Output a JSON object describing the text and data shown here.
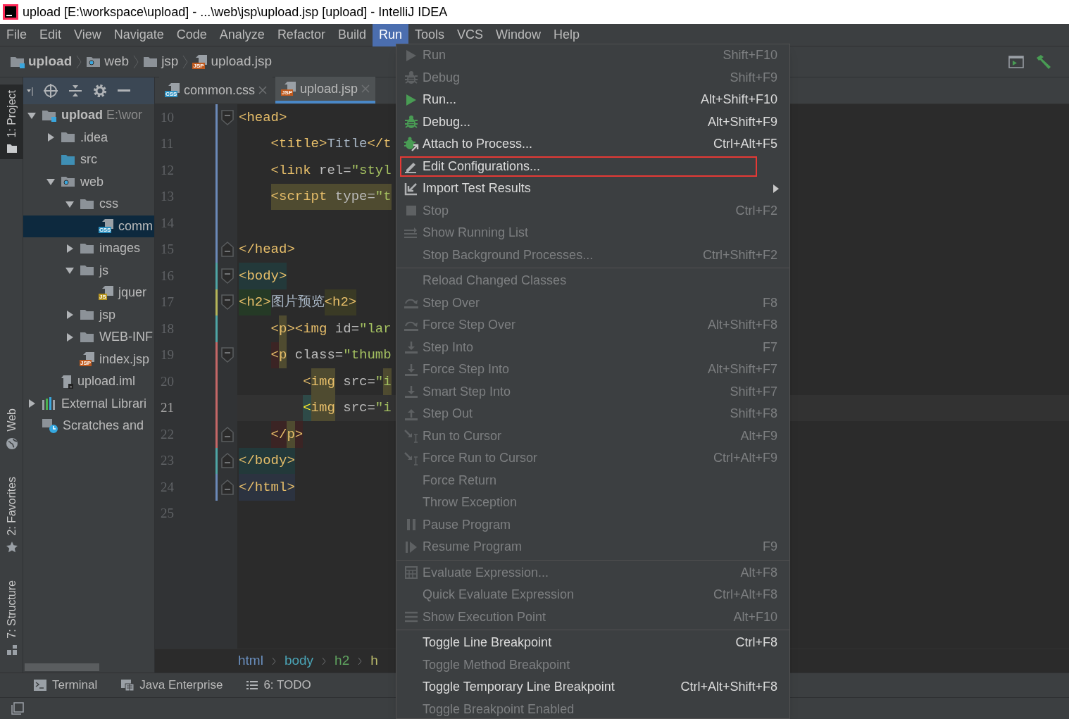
{
  "window": {
    "title": "upload [E:\\workspace\\upload] - ...\\web\\jsp\\upload.jsp [upload] - IntelliJ IDEA"
  },
  "menu_bar": [
    {
      "label": "File",
      "selected": false
    },
    {
      "label": "Edit",
      "selected": false
    },
    {
      "label": "View",
      "selected": false
    },
    {
      "label": "Navigate",
      "selected": false
    },
    {
      "label": "Code",
      "selected": false
    },
    {
      "label": "Analyze",
      "selected": false
    },
    {
      "label": "Refactor",
      "selected": false
    },
    {
      "label": "Build",
      "selected": false
    },
    {
      "label": "Run",
      "selected": true
    },
    {
      "label": "Tools",
      "selected": false
    },
    {
      "label": "VCS",
      "selected": false
    },
    {
      "label": "Window",
      "selected": false
    },
    {
      "label": "Help",
      "selected": false
    }
  ],
  "nav_breadcrumbs": [
    {
      "label": "upload",
      "kind": "module"
    },
    {
      "label": "web",
      "kind": "web-folder"
    },
    {
      "label": "jsp",
      "kind": "folder"
    },
    {
      "label": "upload.jsp",
      "kind": "jsp-file",
      "badge": "JSP"
    }
  ],
  "tool_strip_top": [
    {
      "label": "1: Project",
      "kind": "folder",
      "selected": true
    }
  ],
  "tool_strip_bottom": [
    {
      "label": "Web",
      "kind": "globe",
      "selected": false
    },
    {
      "label": "2: Favorites",
      "kind": "star",
      "selected": false
    },
    {
      "label": "7: Structure",
      "kind": "structure",
      "selected": false
    }
  ],
  "project_tree": [
    {
      "label": "upload",
      "detail": "E:\\wor",
      "kind": "module",
      "expanded": true,
      "selected": false,
      "children": [
        {
          "label": ".idea",
          "kind": "folder",
          "expanded": false,
          "selected": false
        },
        {
          "label": "src",
          "kind": "source-folder",
          "selected": false
        },
        {
          "label": "web",
          "kind": "web-folder",
          "expanded": true,
          "selected": false,
          "children": [
            {
              "label": "css",
              "kind": "folder",
              "expanded": true,
              "selected": false,
              "children": [
                {
                  "label": "comm",
                  "kind": "css-file",
                  "badge": "CSS",
                  "selected": true
                }
              ]
            },
            {
              "label": "images",
              "kind": "folder",
              "expanded": false,
              "selected": false
            },
            {
              "label": "js",
              "kind": "folder",
              "expanded": true,
              "selected": false,
              "children": [
                {
                  "label": "jquer",
                  "kind": "js-file",
                  "badge": "JS",
                  "selected": false
                }
              ]
            },
            {
              "label": "jsp",
              "kind": "folder",
              "expanded": false,
              "selected": false
            },
            {
              "label": "WEB-INF",
              "kind": "folder",
              "expanded": false,
              "selected": false
            },
            {
              "label": "index.jsp",
              "kind": "jsp-file",
              "badge": "JSP",
              "selected": false
            }
          ]
        },
        {
          "label": "upload.iml",
          "kind": "iml-file",
          "selected": false
        }
      ]
    },
    {
      "label": "External Librari",
      "kind": "libraries",
      "expanded": false,
      "selected": false
    },
    {
      "label": "Scratches and",
      "kind": "scratches",
      "selected": false
    }
  ],
  "editor_tabs": [
    {
      "label": "common.css",
      "kind": "css-file",
      "badge": "CSS",
      "selected": false
    },
    {
      "label": "upload.jsp",
      "kind": "jsp-file",
      "badge": "JSP",
      "selected": true
    }
  ],
  "code_lines": [
    {
      "number": "10",
      "color": "#6b89b8",
      "kind": "flat",
      "fold_start": true,
      "fold_end": false,
      "current": false,
      "segments": [
        {
          "text": "<head>",
          "kind": "tag"
        }
      ]
    },
    {
      "number": "11",
      "color": "#6b89b8",
      "kind": "nested",
      "fold_start": false,
      "fold_end": false,
      "current": false,
      "segments": [
        {
          "text": "<title>",
          "kind": "tag"
        },
        {
          "text": "Title",
          "kind": "text"
        },
        {
          "text": "</t",
          "kind": "tag"
        }
      ]
    },
    {
      "number": "12",
      "color": "#6b89b8",
      "kind": "nested",
      "fold_start": false,
      "fold_end": false,
      "current": false,
      "segments": [
        {
          "text": "<link",
          "kind": "tag"
        },
        {
          "text": " rel=",
          "kind": "attr"
        },
        {
          "text": "\"styl",
          "kind": "value"
        }
      ]
    },
    {
      "number": "13",
      "color": "#6b89b8",
      "kind": "nested",
      "fold_start": false,
      "fold_end": false,
      "current": false,
      "segments": [
        {
          "text": "<script",
          "kind": "tag",
          "color": "#4f4b30"
        },
        {
          "text": " type=",
          "kind": "attr",
          "color": "#4f4b30"
        },
        {
          "text": "\"t",
          "kind": "value",
          "color": "#4f4b30"
        }
      ]
    },
    {
      "number": "14",
      "color": "#6b89b8",
      "fold_start": false,
      "fold_end": false,
      "current": false
    },
    {
      "number": "15",
      "color": "#6b89b8",
      "kind": "flat",
      "fold_start": false,
      "fold_end": true,
      "current": false,
      "segments": [
        {
          "text": "</head>",
          "kind": "tag"
        }
      ]
    },
    {
      "number": "16",
      "color": "#4fa5a5",
      "kind": "flat",
      "fold_start": true,
      "fold_end": false,
      "current": false,
      "segments": [
        {
          "text": "<body>",
          "kind": "tag",
          "color": "#23393a"
        }
      ]
    },
    {
      "number": "17",
      "color": "#b5b55a",
      "kind": "flat",
      "fold_start": true,
      "fold_end": false,
      "current": false,
      "segments": [
        {
          "text": "<h2>",
          "kind": "tag",
          "color": "#253a26"
        },
        {
          "text": "图片预览",
          "kind": "text"
        },
        {
          "text": "<h2>",
          "kind": "tag",
          "color": "#3a3a25"
        }
      ]
    },
    {
      "number": "18",
      "color": "#4fa5a5",
      "kind": "nested",
      "fold_start": false,
      "fold_end": false,
      "current": false,
      "segments": [
        {
          "text": "<",
          "kind": "tag"
        },
        {
          "text": "p",
          "kind": "tag",
          "color": "#4f4b30"
        },
        {
          "text": "><img",
          "kind": "tag"
        },
        {
          "text": " id=",
          "kind": "attr"
        },
        {
          "text": "\"lar",
          "kind": "value"
        }
      ]
    },
    {
      "number": "19",
      "color": "#c46767",
      "kind": "nested",
      "fold_start": true,
      "fold_end": false,
      "current": false,
      "segments": [
        {
          "text": "<",
          "kind": "tag",
          "color": "#3b2424"
        },
        {
          "text": "p",
          "kind": "tag",
          "color": "#4f4b30"
        },
        {
          "text": " class=",
          "kind": "attr"
        },
        {
          "text": "\"thumb",
          "kind": "value"
        }
      ]
    },
    {
      "number": "20",
      "color": "#c46767",
      "kind": "deep",
      "fold_start": false,
      "fold_end": false,
      "current": false,
      "segments": [
        {
          "text": "<",
          "kind": "tag"
        },
        {
          "text": "img",
          "kind": "tag",
          "color": "#4f4b30"
        },
        {
          "text": " src=",
          "kind": "attr"
        },
        {
          "text": "\"",
          "kind": "value"
        },
        {
          "text": "i",
          "kind": "value",
          "color": "#4f4b30"
        }
      ]
    },
    {
      "number": "21",
      "color": "#c46767",
      "kind": "deep",
      "fold_start": false,
      "fold_end": false,
      "current": true,
      "segments": [
        {
          "text": "<",
          "kind": "bracket",
          "color": "#2e4a48"
        },
        {
          "text": "img",
          "kind": "tag",
          "color": "#4f4b30"
        },
        {
          "text": " src=",
          "kind": "attr"
        },
        {
          "text": "\"i",
          "kind": "value"
        }
      ]
    },
    {
      "number": "22",
      "color": "#c46767",
      "kind": "nested",
      "fold_start": false,
      "fold_end": true,
      "current": false,
      "segments": [
        {
          "text": "</",
          "kind": "tag",
          "color": "#3b2424"
        },
        {
          "text": "p",
          "kind": "tag",
          "color": "#4f4b30"
        },
        {
          "text": ">",
          "kind": "tag",
          "color": "#3b2424"
        }
      ]
    },
    {
      "number": "23",
      "color": "#4fa5a5",
      "kind": "flat",
      "fold_start": false,
      "fold_end": true,
      "current": false,
      "segments": [
        {
          "text": "</body>",
          "kind": "tag",
          "color": "#23393a"
        }
      ]
    },
    {
      "number": "24",
      "color": "#6b89b8",
      "kind": "flat",
      "fold_start": false,
      "fold_end": true,
      "current": false,
      "segments": [
        {
          "text": "</html>",
          "kind": "tag",
          "color": "#2c3340"
        }
      ]
    },
    {
      "number": "25",
      "fold_start": false,
      "fold_end": false,
      "current": false
    }
  ],
  "editor_breadcrumbs": [
    {
      "label": "html",
      "color": "#6a8fbf"
    },
    {
      "label": "body",
      "color": "#4aa3b5"
    },
    {
      "label": "h2",
      "color": "#5fa35f"
    },
    {
      "label": "h",
      "color": "#b8b86a"
    }
  ],
  "bottom_tools": [
    {
      "label": "Terminal",
      "kind": "terminal"
    },
    {
      "label": "Java Enterprise",
      "kind": "java-ee"
    },
    {
      "label": "6: TODO",
      "kind": "todo"
    }
  ],
  "run_menu": [
    {
      "kind": "play",
      "label": "Run",
      "shortcut": "Shift+F10",
      "disabled": true,
      "boxed": false
    },
    {
      "kind": "bug",
      "label": "Debug",
      "shortcut": "Shift+F9",
      "disabled": true,
      "boxed": false
    },
    {
      "kind": "play",
      "label": "Run...",
      "shortcut": "Alt+Shift+F10",
      "disabled": false,
      "boxed": false
    },
    {
      "kind": "bug",
      "label": "Debug...",
      "shortcut": "Alt+Shift+F9",
      "disabled": false,
      "boxed": false
    },
    {
      "kind": "attach",
      "label": "Attach to Process...",
      "shortcut": "Ctrl+Alt+F5",
      "disabled": false,
      "boxed": false
    },
    {
      "kind": "pencil",
      "label": "Edit Configurations...",
      "disabled": false,
      "boxed": true
    },
    {
      "kind": "import-submenu",
      "label": "Import Test Results",
      "disabled": false,
      "boxed": false
    },
    {
      "kind": "stop",
      "label": "Stop",
      "shortcut": "Ctrl+F2",
      "disabled": true,
      "boxed": false
    },
    {
      "kind": "list",
      "label": "Show Running List",
      "disabled": true,
      "boxed": false
    },
    {
      "kind": "plain",
      "label": "Stop Background Processes...",
      "shortcut": "Ctrl+Shift+F2",
      "disabled": true,
      "boxed": false
    },
    {
      "kind": "separator"
    },
    {
      "kind": "plain",
      "label": "Reload Changed Classes",
      "disabled": true,
      "boxed": false
    },
    {
      "kind": "step-over",
      "label": "Step Over",
      "shortcut": "F8",
      "disabled": true,
      "boxed": false
    },
    {
      "kind": "step-over",
      "label": "Force Step Over",
      "shortcut": "Alt+Shift+F8",
      "disabled": true,
      "boxed": false
    },
    {
      "kind": "step-into",
      "label": "Step Into",
      "shortcut": "F7",
      "disabled": true,
      "boxed": false
    },
    {
      "kind": "step-into",
      "label": "Force Step Into",
      "shortcut": "Alt+Shift+F7",
      "disabled": true,
      "boxed": false
    },
    {
      "kind": "step-into",
      "label": "Smart Step Into",
      "shortcut": "Shift+F7",
      "disabled": true,
      "boxed": false
    },
    {
      "kind": "step-out",
      "label": "Step Out",
      "shortcut": "Shift+F8",
      "disabled": true,
      "boxed": false
    },
    {
      "kind": "cursor",
      "label": "Run to Cursor",
      "shortcut": "Alt+F9",
      "disabled": true,
      "boxed": false
    },
    {
      "kind": "cursor",
      "label": "Force Run to Cursor",
      "shortcut": "Ctrl+Alt+F9",
      "disabled": true,
      "boxed": false
    },
    {
      "kind": "plain",
      "label": "Force Return",
      "disabled": true,
      "boxed": false
    },
    {
      "kind": "plain",
      "label": "Throw Exception",
      "disabled": true,
      "boxed": false
    },
    {
      "kind": "pause",
      "label": "Pause Program",
      "disabled": true,
      "boxed": false
    },
    {
      "kind": "resume",
      "label": "Resume Program",
      "shortcut": "F9",
      "disabled": true,
      "boxed": false
    },
    {
      "kind": "separator"
    },
    {
      "kind": "calculator",
      "label": "Evaluate Expression...",
      "shortcut": "Alt+F8",
      "disabled": true,
      "boxed": false
    },
    {
      "kind": "plain",
      "label": "Quick Evaluate Expression",
      "shortcut": "Ctrl+Alt+F8",
      "disabled": true,
      "boxed": false
    },
    {
      "kind": "lines",
      "label": "Show Execution Point",
      "shortcut": "Alt+F10",
      "disabled": true,
      "boxed": false
    },
    {
      "kind": "separator"
    },
    {
      "kind": "plain",
      "label": "Toggle Line Breakpoint",
      "shortcut": "Ctrl+F8",
      "disabled": false,
      "boxed": false
    },
    {
      "kind": "plain",
      "label": "Toggle Method Breakpoint",
      "disabled": true,
      "boxed": false
    },
    {
      "kind": "plain",
      "label": "Toggle Temporary Line Breakpoint",
      "shortcut": "Ctrl+Alt+Shift+F8",
      "disabled": false,
      "boxed": false
    },
    {
      "kind": "plain",
      "label": "Toggle Breakpoint Enabled",
      "disabled": true,
      "boxed": false
    }
  ]
}
